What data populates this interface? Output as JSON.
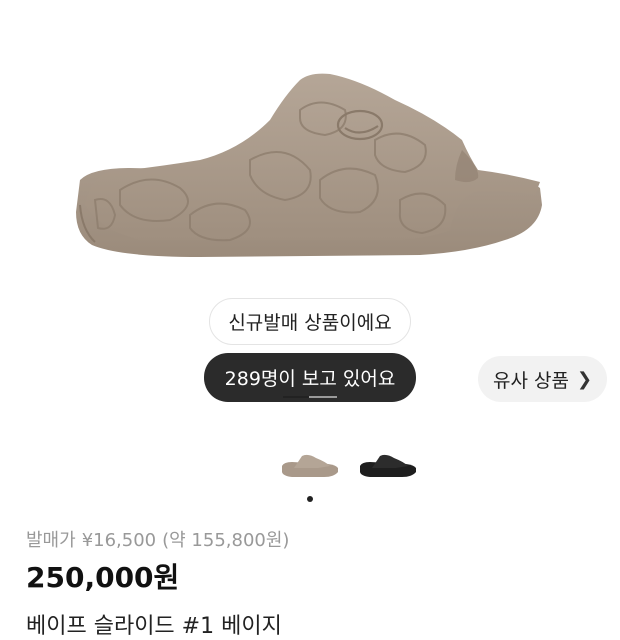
{
  "badges": {
    "new_release": "신규발매 상품이에요",
    "viewers": "289명이 보고 있어요"
  },
  "similar_button": {
    "label": "유사 상품",
    "icon": "chevron-right-icon"
  },
  "carousel": {
    "current_index": 1,
    "thumbnails": [
      {
        "color": "beige",
        "selected": true
      },
      {
        "color": "black",
        "selected": false
      }
    ]
  },
  "pricing": {
    "release_label": "발매가",
    "release_price": "¥16,500",
    "release_krw": "(약 155,800원)",
    "price": "250,000원"
  },
  "product": {
    "name": "베이프 슬라이드 #1 베이지"
  },
  "colors": {
    "slide_beige": "#a9998a",
    "dark_pill": "#2b2b2b"
  }
}
